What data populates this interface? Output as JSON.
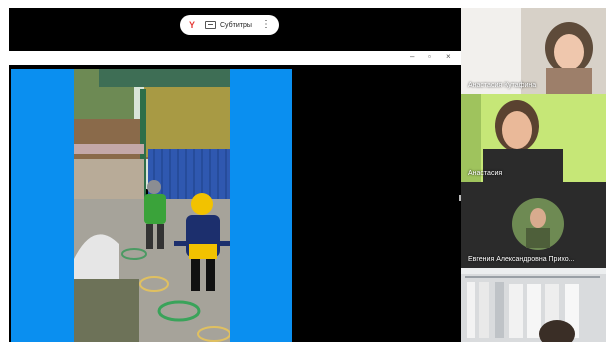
{
  "toolbar": {
    "logo_glyph": "Y",
    "subtitles_label": "Субтитры",
    "more_glyph": "⋮"
  },
  "share_window": {
    "minimize_glyph": "–",
    "restore_glyph": "▫",
    "close_glyph": "×"
  },
  "participants": [
    {
      "name": "Анастасия Кутафина"
    },
    {
      "name": "Анастасия"
    },
    {
      "name": "Евгения Александровна Прихо..."
    },
    {
      "name": ""
    }
  ],
  "colors": {
    "accent_blue": "#0a8ff0",
    "brand_red": "#e53935",
    "stage_black": "#000000"
  }
}
